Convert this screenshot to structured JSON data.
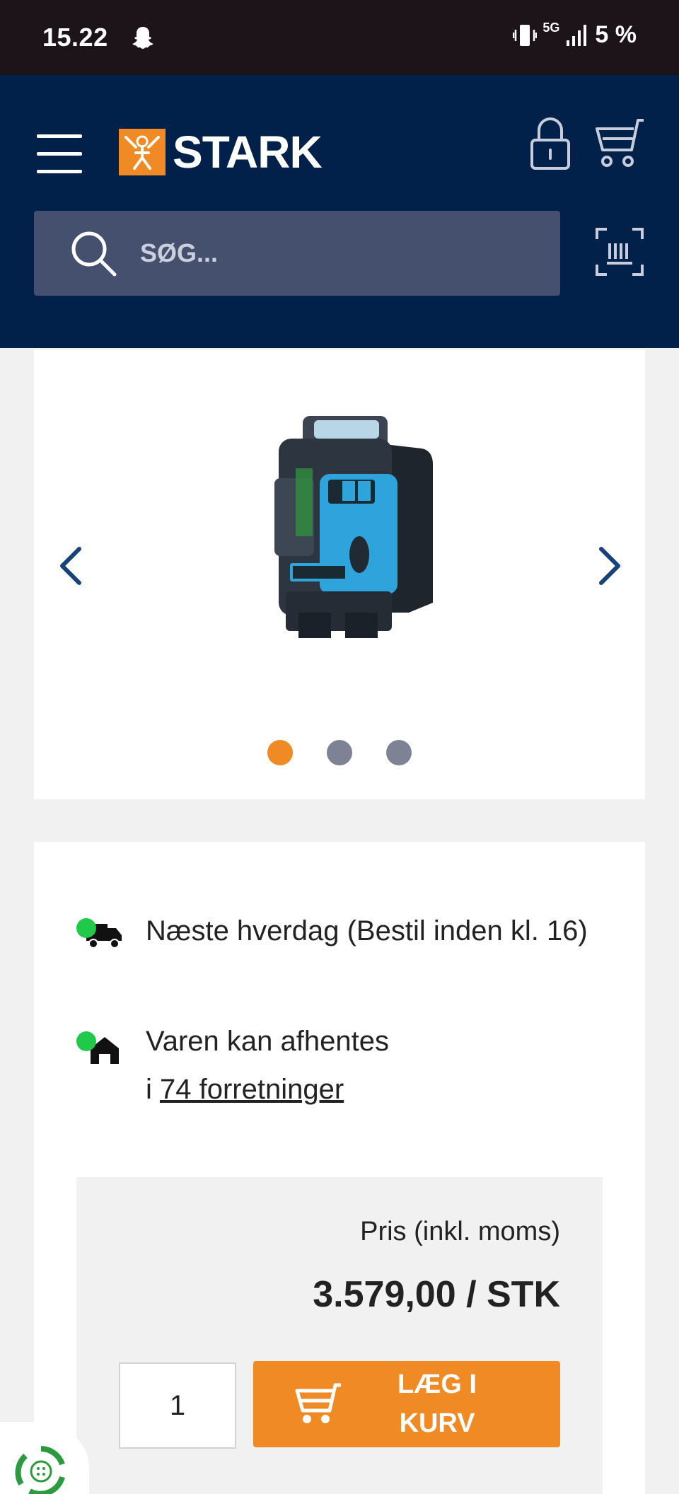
{
  "status_bar": {
    "time": "15.22",
    "network": "5G",
    "battery": "5 %",
    "icons": [
      "snapchat-ghost-icon",
      "vibrate-icon",
      "signal-icon"
    ]
  },
  "header": {
    "logo_text": "STARK",
    "search_placeholder": "SØG...",
    "icons": [
      "hamburger-menu-icon",
      "lock-icon",
      "cart-icon",
      "search-icon",
      "barcode-scan-icon"
    ],
    "brand_color": "#02214a",
    "accent_color": "#f08a24"
  },
  "gallery": {
    "slides": 3,
    "active_index": 0,
    "icons": [
      "chevron-left-icon",
      "chevron-right-icon"
    ]
  },
  "availability": {
    "delivery_text": "Næste hverdag (Bestil inden kl. 16)",
    "pickup_prefix": "Varen kan afhentes",
    "pickup_i": "i",
    "pickup_link": "74 forretninger",
    "status_color": "#21c94a",
    "icons": [
      "truck-icon",
      "store-icon"
    ]
  },
  "price": {
    "label": "Pris (inkl. moms)",
    "value": "3.579,00 / STK",
    "quantity": "1",
    "add_button_label": "LÆG I KURV"
  }
}
